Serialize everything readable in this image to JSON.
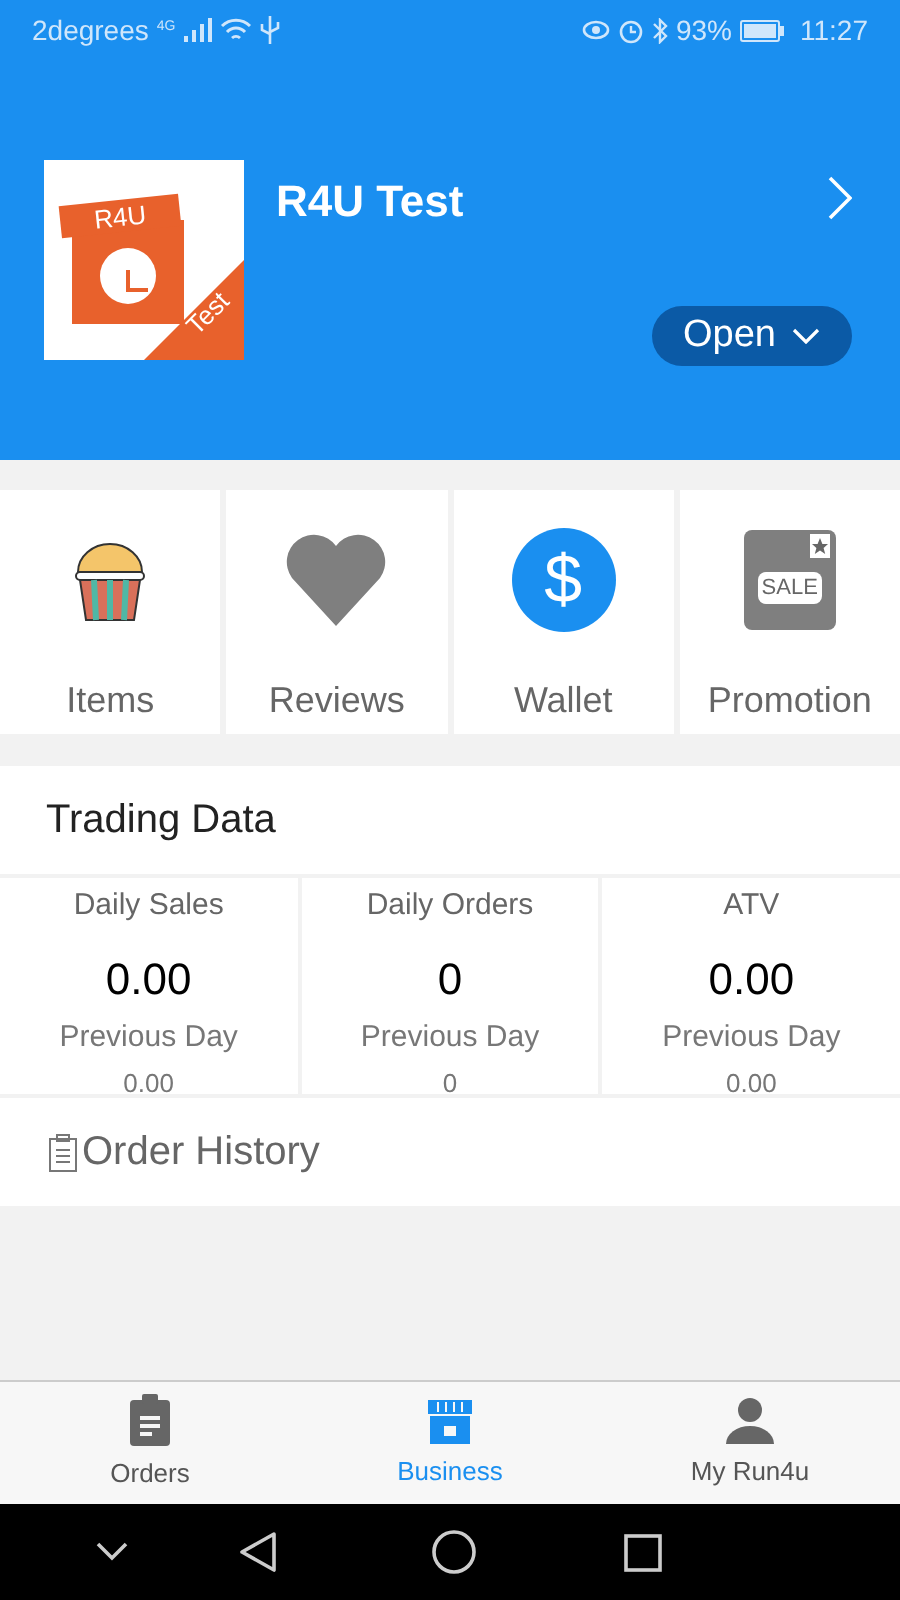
{
  "status_bar": {
    "carrier": "2degrees",
    "network": "4G",
    "battery": "93%",
    "time": "11:27"
  },
  "store": {
    "logo_top": "R4U",
    "logo_corner": "Test",
    "name": "R4U Test",
    "status": "Open"
  },
  "tiles": [
    {
      "kind": "cupcake",
      "label": "Items"
    },
    {
      "kind": "heart",
      "label": "Reviews"
    },
    {
      "kind": "dollar",
      "label": "Wallet",
      "icon_text": "$"
    },
    {
      "kind": "sale",
      "label": "Promotion",
      "icon_text": "SALE"
    }
  ],
  "trading_data": {
    "title": "Trading Data",
    "metrics": [
      {
        "label": "Daily Sales",
        "value": "0.00",
        "previous_label": "Previous Day",
        "previous_value": "0.00"
      },
      {
        "label": "Daily Orders",
        "value": "0",
        "previous_label": "Previous Day",
        "previous_value": "0"
      },
      {
        "label": "ATV",
        "value": "0.00",
        "previous_label": "Previous Day",
        "previous_value": "0.00"
      }
    ]
  },
  "order_history": {
    "title": "Order History"
  },
  "bottom_nav": [
    {
      "kind": "clipboard",
      "label": "Orders",
      "selected": false
    },
    {
      "kind": "store",
      "label": "Business",
      "selected": true
    },
    {
      "kind": "person",
      "label": "My Run4u",
      "selected": false
    }
  ]
}
